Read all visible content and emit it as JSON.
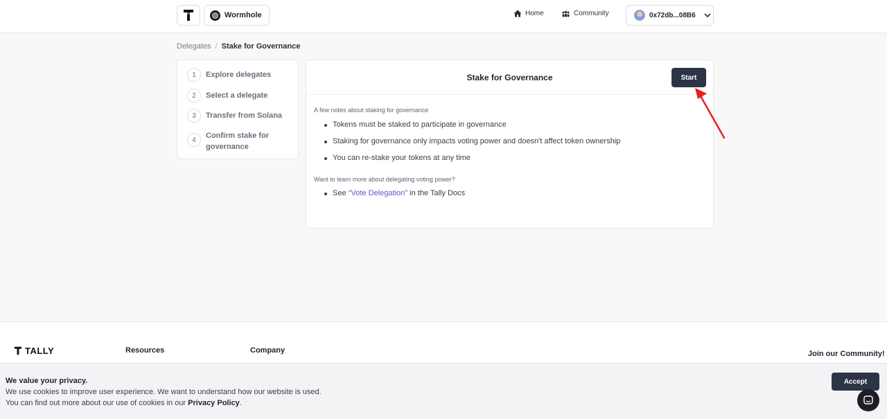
{
  "header": {
    "dao_name": "Wormhole",
    "nav": {
      "home": "Home",
      "community": "Community"
    },
    "wallet": "0x72db...08B6"
  },
  "breadcrumb": {
    "parent": "Delegates",
    "separator": "/",
    "current": "Stake for Governance"
  },
  "steps": [
    {
      "num": "1",
      "label": "Explore delegates"
    },
    {
      "num": "2",
      "label": "Select a delegate"
    },
    {
      "num": "3",
      "label": "Transfer from Solana"
    },
    {
      "num": "4",
      "label": "Confirm stake for governance"
    }
  ],
  "main": {
    "title": "Stake for Governance",
    "start_label": "Start",
    "notes_title": "A few notes about staking for governance",
    "notes": [
      "Tokens must be staked to participate in governance",
      "Staking for governance only impacts voting power and doesn't affect token ownership",
      "You can re-stake your tokens at any time"
    ],
    "learn_title": "Want to learn more about delegating voting power?",
    "learn_prefix": "See ",
    "learn_link": "\"Vote Delegation\"",
    "learn_suffix": " in the Tally Docs"
  },
  "footer": {
    "brand": "TALLY",
    "resources": "Resources",
    "company": "Company",
    "join": "Join our Community!"
  },
  "cookie": {
    "title": "We value your privacy.",
    "line1": "We use cookies to improve user experience. We want to understand how our website is used.",
    "line2_prefix": "You can find out more about our use of cookies in our ",
    "line2_link": "Privacy Policy",
    "line2_suffix": ".",
    "accept_label": "Accept"
  },
  "colors": {
    "primary_button": "#2c3446",
    "link": "#6b4fd1",
    "annotation_arrow": "#e8201c"
  }
}
